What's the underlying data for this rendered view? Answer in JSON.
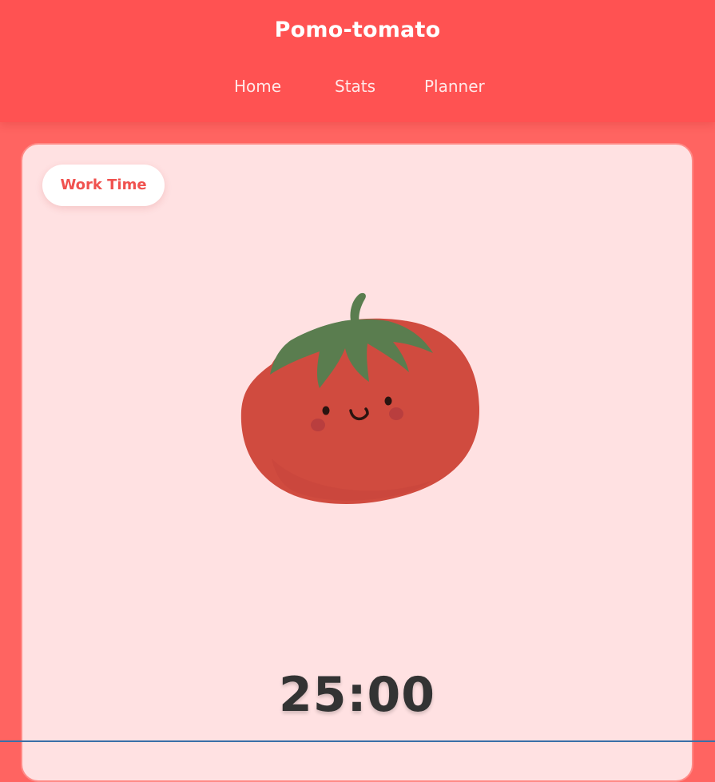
{
  "header": {
    "title": "Pomo-tomato",
    "nav": [
      {
        "label": "Home"
      },
      {
        "label": "Stats"
      },
      {
        "label": "Planner"
      }
    ]
  },
  "timer_card": {
    "mode_label": "Work Time",
    "illustration": "smiling-tomato-illustration",
    "time_display": "25:00"
  },
  "colors": {
    "header_bg": "#ff5252",
    "page_bg": "#ff6461",
    "card_bg": "#ffe1e2",
    "accent_text": "#f0524f",
    "tomato_red": "#d04b3f",
    "leaf_green": "#5a7d4f"
  }
}
